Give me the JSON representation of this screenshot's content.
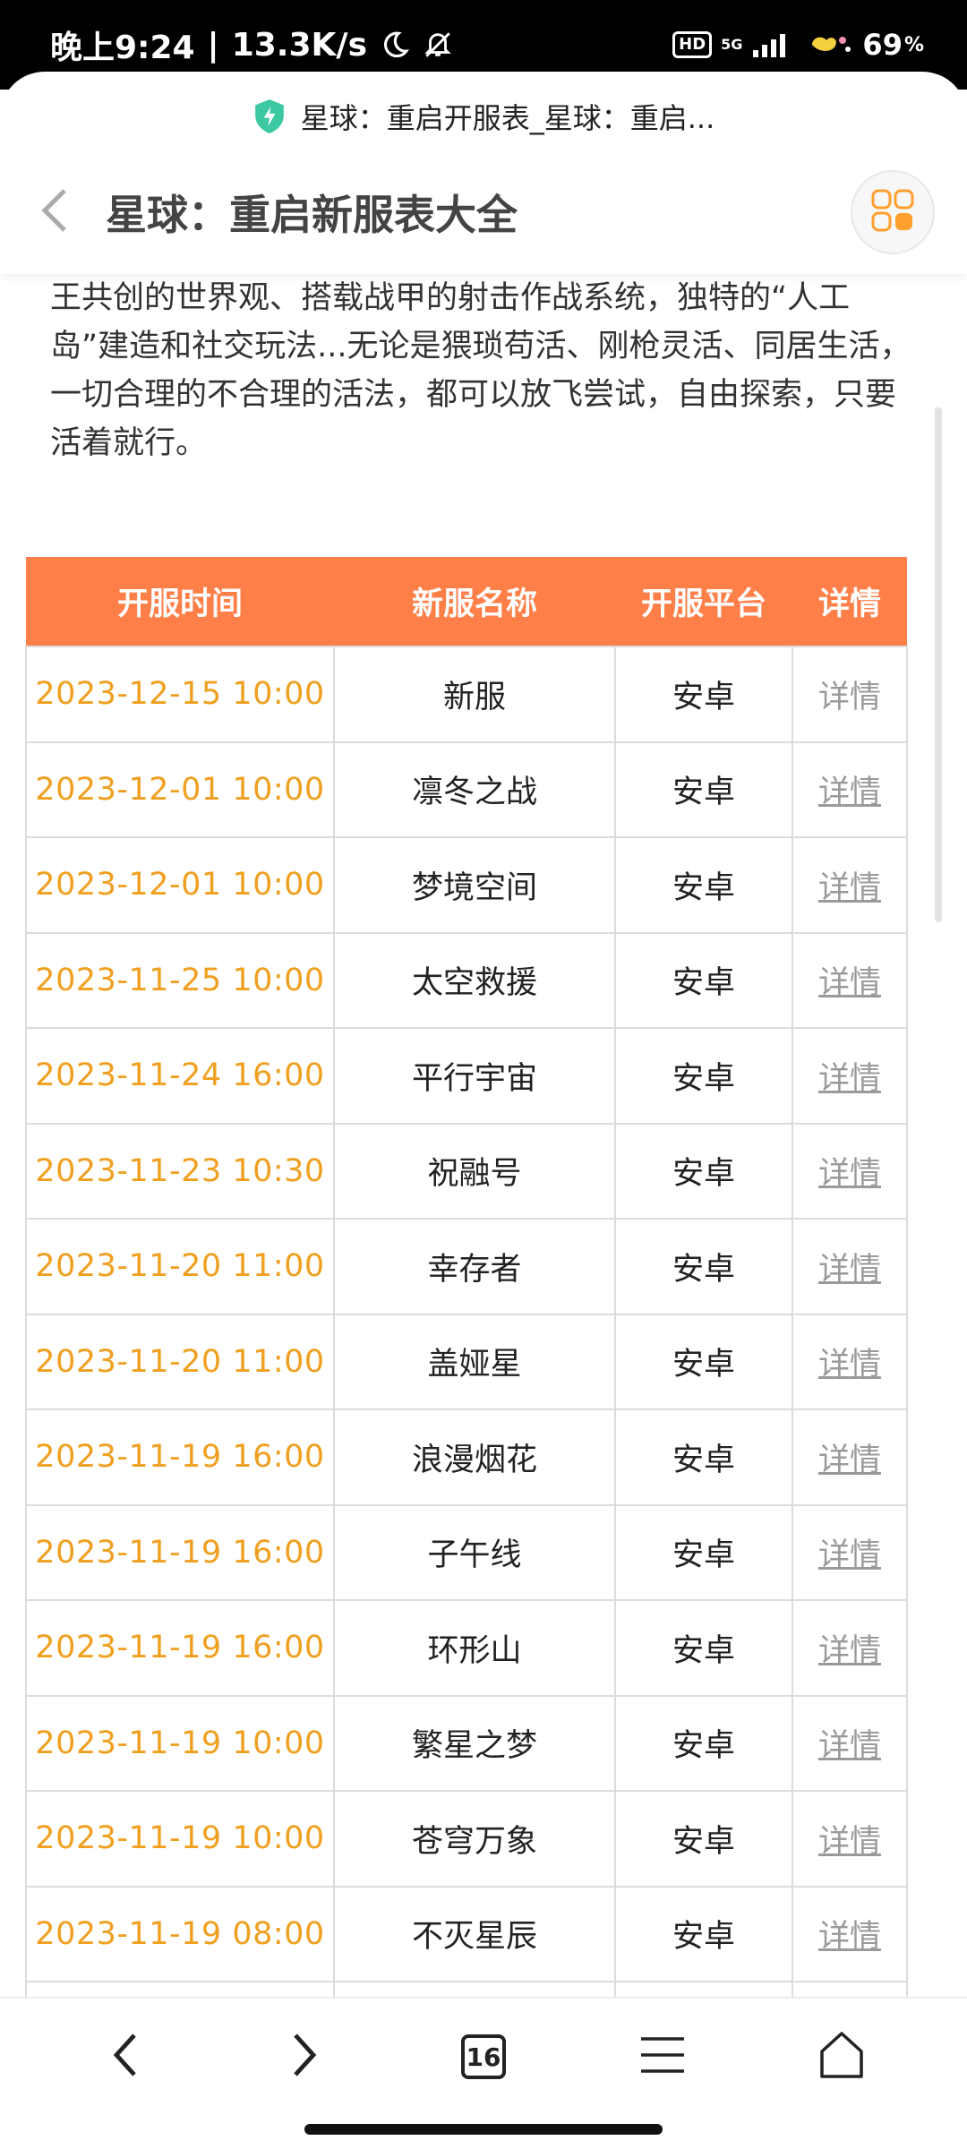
{
  "status_bar": {
    "time": "晚上9:24",
    "speed": "13.3K/s",
    "hd": "HD",
    "network": "5G",
    "battery": "69",
    "battery_unit": "%"
  },
  "browser": {
    "url_title": "星球：重启开服表_星球：重启...",
    "tab_count": "16"
  },
  "header": {
    "title": "星球：重启新服表大全"
  },
  "intro_text": "颠覆品类的画质革命、遥遥领先的降肝减氪改革、中国科幻天王共创的世界观、搭载战甲的射击作战系统，独特的“人工岛”建造和社交玩法...无论是猥琐苟活、刚枪灵活、同居生活，一切合理的不合理的活法，都可以放飞尝试，自由探索，只要活着就行。",
  "table": {
    "headers": [
      "开服时间",
      "新服名称",
      "开服平台",
      "详情"
    ],
    "rows": [
      {
        "time": "2023-12-15 10:00",
        "name": "新服",
        "platform": "安卓",
        "detail": "详情",
        "linked": false
      },
      {
        "time": "2023-12-01 10:00",
        "name": "凛冬之战",
        "platform": "安卓",
        "detail": "详情",
        "linked": true
      },
      {
        "time": "2023-12-01 10:00",
        "name": "梦境空间",
        "platform": "安卓",
        "detail": "详情",
        "linked": true
      },
      {
        "time": "2023-11-25 10:00",
        "name": "太空救援",
        "platform": "安卓",
        "detail": "详情",
        "linked": true
      },
      {
        "time": "2023-11-24 16:00",
        "name": "平行宇宙",
        "platform": "安卓",
        "detail": "详情",
        "linked": true
      },
      {
        "time": "2023-11-23 10:30",
        "name": "祝融号",
        "platform": "安卓",
        "detail": "详情",
        "linked": true
      },
      {
        "time": "2023-11-20 11:00",
        "name": "幸存者",
        "platform": "安卓",
        "detail": "详情",
        "linked": true
      },
      {
        "time": "2023-11-20 11:00",
        "name": "盖娅星",
        "platform": "安卓",
        "detail": "详情",
        "linked": true
      },
      {
        "time": "2023-11-19 16:00",
        "name": "浪漫烟花",
        "platform": "安卓",
        "detail": "详情",
        "linked": true
      },
      {
        "time": "2023-11-19 16:00",
        "name": "子午线",
        "platform": "安卓",
        "detail": "详情",
        "linked": true
      },
      {
        "time": "2023-11-19 16:00",
        "name": "环形山",
        "platform": "安卓",
        "detail": "详情",
        "linked": true
      },
      {
        "time": "2023-11-19 10:00",
        "name": "繁星之梦",
        "platform": "安卓",
        "detail": "详情",
        "linked": true
      },
      {
        "time": "2023-11-19 10:00",
        "name": "苍穹万象",
        "platform": "安卓",
        "detail": "详情",
        "linked": true
      },
      {
        "time": "2023-11-19 08:00",
        "name": "不灭星辰",
        "platform": "安卓",
        "detail": "详情",
        "linked": true
      },
      {
        "time": "",
        "name": "",
        "platform": "",
        "detail": "",
        "linked": false
      }
    ]
  },
  "colors": {
    "table_header": "#ff7f48",
    "time_text": "#f0a020",
    "detail_link": "#9a9a9a",
    "shield": "#3cc8a0"
  },
  "icons": {
    "back": "chevron-left-icon",
    "apps": "apps-grid-icon",
    "shield": "shield-icon",
    "nav_back": "chevron-left-icon",
    "nav_forward": "chevron-right-icon",
    "menu": "menu-icon",
    "home": "home-icon"
  }
}
